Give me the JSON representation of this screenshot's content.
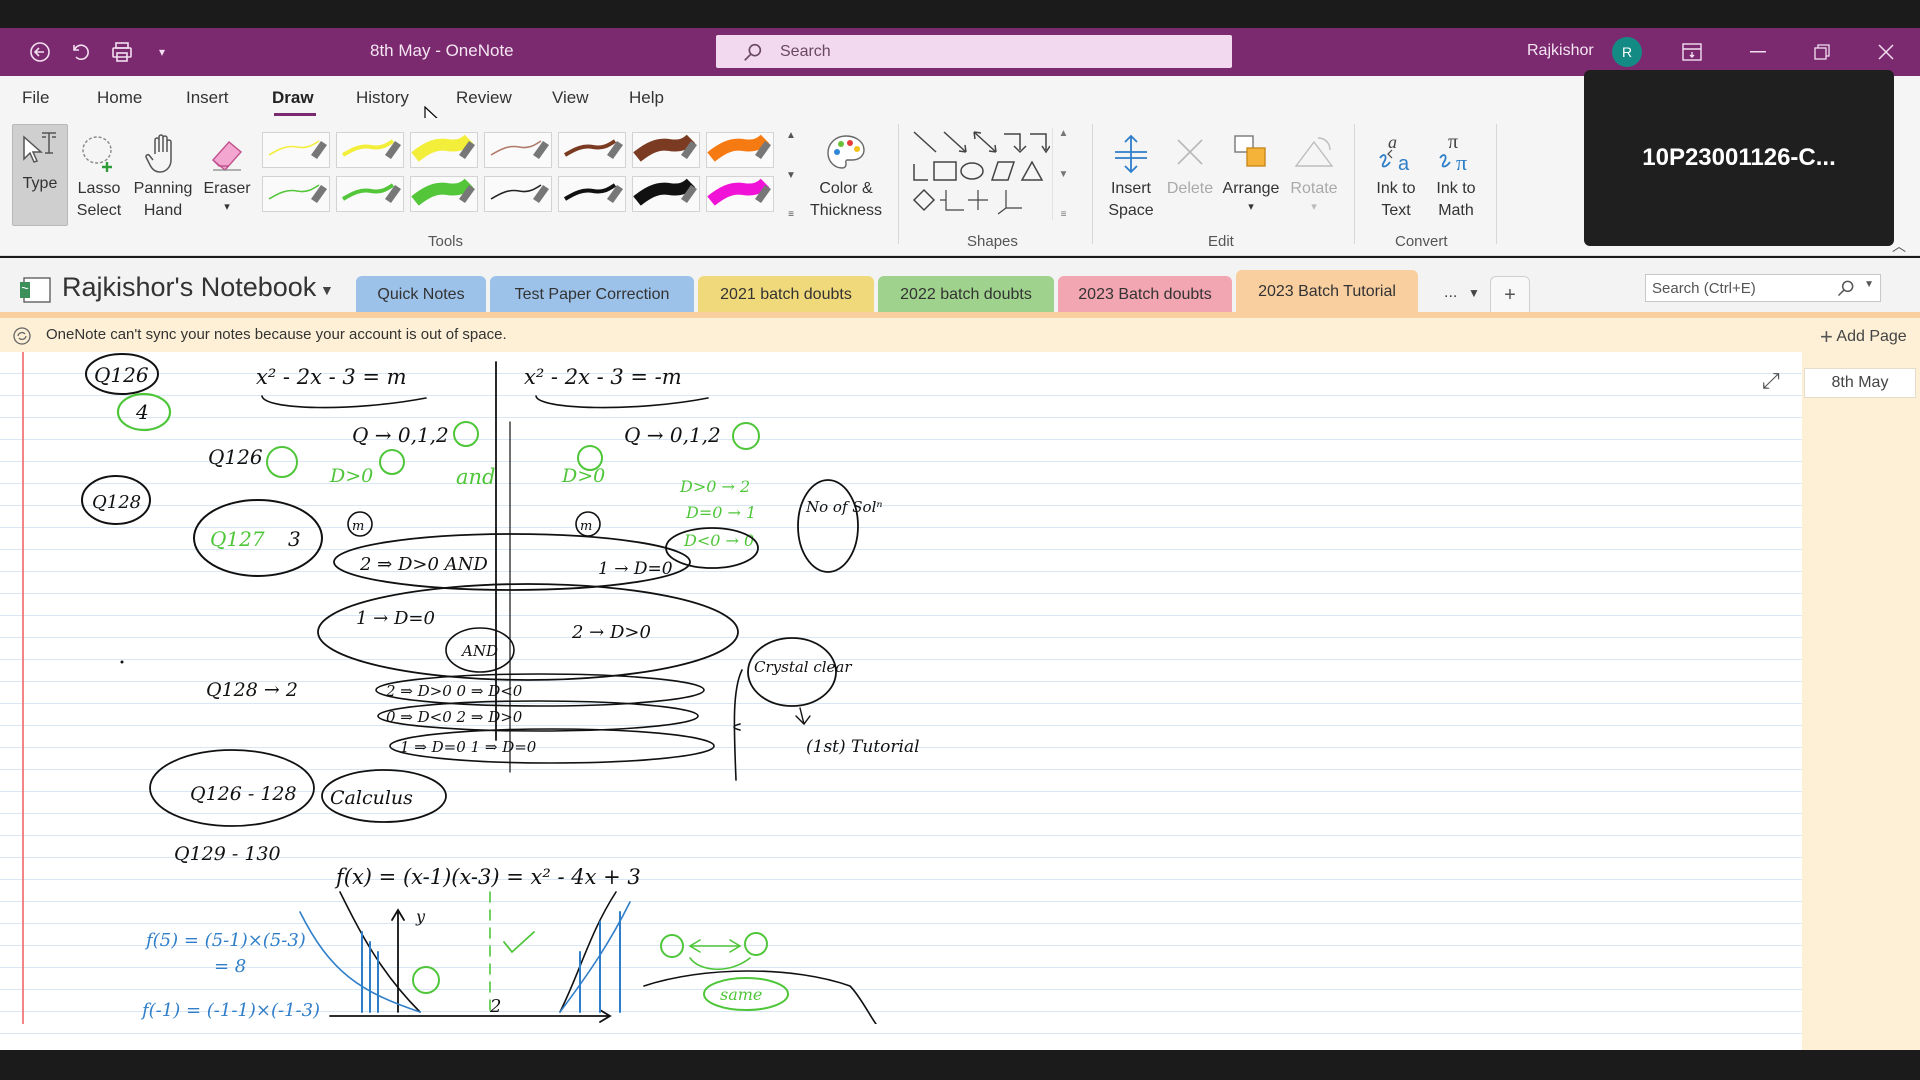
{
  "titlebar": {
    "document_title": "8th May  -  OneNote",
    "search_placeholder": "Search",
    "user_name": "Rajkishor",
    "avatar_initial": "R"
  },
  "menu": {
    "items": [
      "File",
      "Home",
      "Insert",
      "Draw",
      "History",
      "Review",
      "View",
      "Help"
    ],
    "active": "Draw"
  },
  "ribbon": {
    "tools": {
      "type_label": "Type",
      "lasso_label": "Lasso\nSelect",
      "panning_label": "Panning\nHand",
      "eraser_label": "Eraser",
      "color_label": "Color &\nThickness",
      "group_label": "Tools"
    },
    "pens": [
      {
        "color": "#f2ee3a",
        "thick": "thin"
      },
      {
        "color": "#f2ee3a",
        "thick": "medium"
      },
      {
        "color": "#f2ee3a",
        "thick": "highlighter"
      },
      {
        "color": "#b07a68",
        "thick": "thin"
      },
      {
        "color": "#7a3b22",
        "thick": "medium"
      },
      {
        "color": "#7a3b22",
        "thick": "highlighter"
      },
      {
        "color": "#f57a12",
        "thick": "highlighter"
      },
      {
        "color": "#54c63a",
        "thick": "thin"
      },
      {
        "color": "#54c63a",
        "thick": "medium"
      },
      {
        "color": "#54c63a",
        "thick": "highlighter"
      },
      {
        "color": "#222222",
        "thick": "thin"
      },
      {
        "color": "#111111",
        "thick": "medium"
      },
      {
        "color": "#111111",
        "thick": "highlighter"
      },
      {
        "color": "#f012d6",
        "thick": "highlighter"
      }
    ],
    "shapes_group": "Shapes",
    "edit": {
      "insert_space": "Insert\nSpace",
      "delete": "Delete",
      "arrange": "Arrange",
      "rotate": "Rotate",
      "group_label": "Edit"
    },
    "convert": {
      "ink_to_text": "Ink to\nText",
      "ink_to_math": "Ink to\nMath",
      "group_label": "Convert"
    }
  },
  "overlay": {
    "meeting_label": "10P23001126-C..."
  },
  "notebook": {
    "title": "Rajkishor's Notebook",
    "tabs": [
      {
        "label": "Quick Notes",
        "color": "#9cc2ea"
      },
      {
        "label": "Test Paper Correction",
        "color": "#9cc2ea"
      },
      {
        "label": "2021 batch doubts",
        "color": "#f0d97a"
      },
      {
        "label": "2022 batch doubts",
        "color": "#9fd38d"
      },
      {
        "label": "2023 Batch doubts",
        "color": "#f2a6b2"
      },
      {
        "label": "2023 Batch Tutorial",
        "color": "#f9cfa0"
      }
    ],
    "more_label": "...",
    "add_tab_label": "+",
    "search_placeholder": "Search (Ctrl+E)"
  },
  "infobar": {
    "message": "OneNote can't sync your notes because your account is out of space."
  },
  "pages_pane": {
    "add_page_label": "Add Page",
    "pages": [
      "8th May"
    ]
  },
  "handwriting": {
    "q126": "Q126",
    "q126_ans": "4",
    "q126_b": "Q126",
    "q128": "Q128",
    "q127": "Q127",
    "q127_ans": "3",
    "eq_left": "x² - 2x - 3 = m",
    "eq_right": "x² - 2x - 3 = -m",
    "q_left": "Q → 0,1,2",
    "q_right": "Q → 0,1,2",
    "d_left": "D>0",
    "and_word": "and",
    "d_right": "D>0",
    "m_label": "m",
    "d_list": [
      "D>0 → 2",
      "D=0 → 1",
      "D<0 → 0"
    ],
    "no_of_sol": "No of Solⁿ",
    "case_a": "2 ⇒ D>0 AND",
    "case_a2": "1 → D=0",
    "case_b": "1 → D=0",
    "case_b2": "2 → D>0",
    "case_b_and": "AND",
    "q128b": "Q128 → 2",
    "rows": [
      "2 ⇒ D>0      0 ⇒ D<0",
      "0 ⇒ D<0      2 ⇒ D>0",
      "1 ⇒ D=0      1 ⇒ D=0"
    ],
    "crystal_clear": "Crystal clear",
    "tutorial": "(1st) Tutorial",
    "q126_128": "Q126 - 128",
    "calculus": "Calculus",
    "q129_130": "Q129 - 130",
    "fx": "f(x) = (x-1)(x-3) = x² - 4x + 3",
    "f5_a": "f(5) = (5-1)×(5-3)",
    "f5_b": "= 8",
    "fm1": "f(-1) = (-1-1)×(-1-3)",
    "same": "same",
    "y_axis": "y",
    "two": "2"
  }
}
